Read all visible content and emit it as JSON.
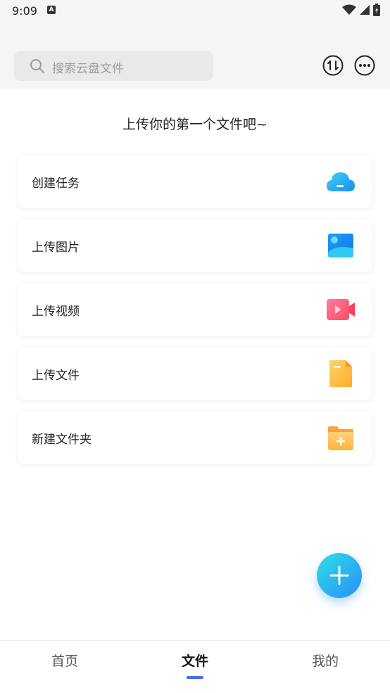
{
  "status_bar": {
    "time": "9:09",
    "keyboard_indicator": "A"
  },
  "search": {
    "placeholder": "搜索云盘文件"
  },
  "header_icons": [
    "sort-icon",
    "more-options-icon"
  ],
  "hint": "上传你的第一个文件吧~",
  "actions": [
    {
      "label": "创建任务",
      "icon": "cloud-download-icon"
    },
    {
      "label": "上传图片",
      "icon": "image-icon"
    },
    {
      "label": "上传视频",
      "icon": "video-icon"
    },
    {
      "label": "上传文件",
      "icon": "document-icon"
    },
    {
      "label": "新建文件夹",
      "icon": "folder-add-icon"
    }
  ],
  "nav": [
    {
      "label": "首页",
      "active": false
    },
    {
      "label": "文件",
      "active": true
    },
    {
      "label": "我的",
      "active": false
    }
  ],
  "colors": {
    "accent": "#4a6bf0",
    "fab": "#2a8ff7"
  }
}
